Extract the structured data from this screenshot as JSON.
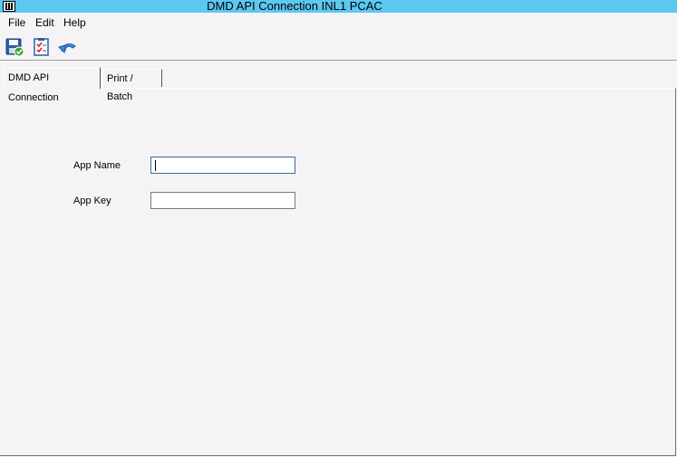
{
  "window": {
    "title": "DMD API Connection INL1 PCAC",
    "icon": "app-logo-icon"
  },
  "menu": {
    "items": [
      {
        "label": "File"
      },
      {
        "label": "Edit"
      },
      {
        "label": "Help"
      }
    ]
  },
  "toolbar": {
    "buttons": [
      {
        "icon": "save-icon",
        "name": "save"
      },
      {
        "icon": "checklist-icon",
        "name": "validate"
      },
      {
        "icon": "undo-icon",
        "name": "undo"
      }
    ]
  },
  "tabs": [
    {
      "label": "DMD API Connection",
      "active": true
    },
    {
      "label": "Print / Batch",
      "active": false
    }
  ],
  "form": {
    "app_name": {
      "label": "App Name",
      "value": ""
    },
    "app_key": {
      "label": "App Key",
      "value": ""
    }
  },
  "colors": {
    "titlebar": "#5cc8f0",
    "background": "#f5f3f5"
  }
}
